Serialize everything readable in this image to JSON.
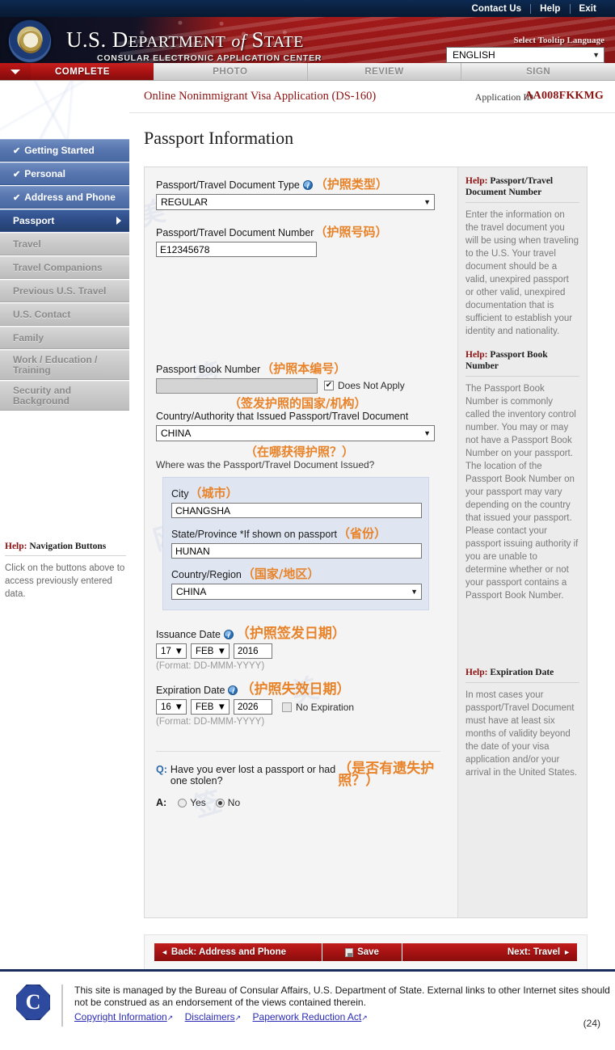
{
  "utility": {
    "links": [
      "Contact Us",
      "Help",
      "Exit"
    ]
  },
  "banner": {
    "title_us": "U.S.",
    "title_dept": "D",
    "title_dept_rest": "EPARTMENT",
    "title_of": "of",
    "title_state_s": "S",
    "title_state_rest": "TATE",
    "subtitle": "CONSULAR ELECTRONIC APPLICATION CENTER",
    "tooltip_label": "Select Tooltip Language",
    "language_value": "ENGLISH",
    "caret": "▼"
  },
  "steps": [
    {
      "label": "COMPLETE",
      "state": "active"
    },
    {
      "label": "PHOTO",
      "state": "inactive"
    },
    {
      "label": "REVIEW",
      "state": "inactive"
    },
    {
      "label": "SIGN",
      "state": "inactive"
    }
  ],
  "sidebar": {
    "items": [
      {
        "label": "Getting Started",
        "state": "done",
        "check": "✔"
      },
      {
        "label": "Personal",
        "state": "done",
        "check": "✔"
      },
      {
        "label": "Address and Phone",
        "state": "done",
        "check": "✔"
      },
      {
        "label": "Passport",
        "state": "current",
        "check": ""
      },
      {
        "label": "Travel",
        "state": "disabled",
        "check": ""
      },
      {
        "label": "Travel Companions",
        "state": "disabled",
        "check": ""
      },
      {
        "label": "Previous U.S. Travel",
        "state": "disabled",
        "check": ""
      },
      {
        "label": "U.S. Contact",
        "state": "disabled",
        "check": ""
      },
      {
        "label": "Family",
        "state": "disabled",
        "check": ""
      },
      {
        "label": "Work / Education /",
        "label2": "Training",
        "state": "disabled",
        "check": ""
      },
      {
        "label": "Security and",
        "label2": "Background",
        "state": "disabled",
        "check": ""
      }
    ],
    "help": {
      "title_word": "Help:",
      "title_rest": " Navigation Buttons",
      "body": "Click on the buttons above to access previously entered data."
    }
  },
  "content": {
    "app_title": "Online Nonimmigrant Visa Application (DS-160)",
    "app_id_label": "Application ID",
    "app_id_value": "AA008FKKMG",
    "page_title": "Passport Information"
  },
  "form": {
    "doc_type": {
      "label": "Passport/Travel Document Type",
      "cn": "（护照类型）",
      "value": "REGULAR"
    },
    "doc_number": {
      "label": "Passport/Travel Document Number",
      "cn": "（护照号码）",
      "value": "E12345678"
    },
    "book_number": {
      "label": "Passport Book Number",
      "cn": "（护照本编号）",
      "value": "",
      "checkbox_label": "Does Not Apply",
      "checkbox_checked": true,
      "check_glyph": "✔"
    },
    "issuing_country": {
      "label": "Country/Authority that Issued Passport/Travel Document",
      "cn": "（签发护照的国家/机构）",
      "value": "CHINA"
    },
    "where_issued": {
      "label": "Where was the Passport/Travel Document Issued?",
      "cn": "（在哪获得护照？）"
    },
    "city": {
      "label": "City",
      "cn": "（城市）",
      "value": "CHANGSHA"
    },
    "state_province": {
      "label": "State/Province *If shown on passport",
      "cn": "（省份）",
      "value": "HUNAN"
    },
    "country_region": {
      "label": "Country/Region",
      "cn": "（国家/地区）",
      "value": "CHINA"
    },
    "issuance_date": {
      "label": "Issuance Date",
      "cn": "（护照签发日期）",
      "day": "17",
      "month": "FEB",
      "year": "2016",
      "format": "(Format: DD-MMM-YYYY)"
    },
    "expiration_date": {
      "label": "Expiration Date",
      "cn": "（护照失效日期）",
      "day": "16",
      "month": "FEB",
      "year": "2026",
      "format": "(Format: DD-MMM-YYYY)",
      "no_expiration_label": "No Expiration",
      "no_expiration_checked": false
    },
    "question": {
      "q_tag": "Q:",
      "q_text": "Have you ever lost a passport or had one stolen?",
      "cn": "（是否有遗失护照？）",
      "a_tag": "A:",
      "option_yes": "Yes",
      "option_no": "No",
      "selected": "No"
    }
  },
  "help_panel": [
    {
      "title_word": "Help:",
      "title_rest": " Passport/Travel Document Number",
      "body": "Enter the information on the travel document you will be using when traveling to the U.S. Your travel document should be a valid, unexpired passport or other valid, unexpired documentation that is sufficient to establish your identity and nationality."
    },
    {
      "title_word": "Help:",
      "title_rest": " Passport Book Number",
      "body": "The Passport Book Number is commonly called the inventory control number. You may or may not have a Passport Book Number on your passport. The location of the Passport Book Number on your passport may vary depending on the country that issued your passport. Please contact your passport issuing authority if you are unable to determine whether or not your passport contains a Passport Book Number."
    },
    {
      "title_word": "Help:",
      "title_rest": " Expiration Date",
      "body": "In most cases your passport/Travel Document must have at least six months of validity beyond the date of your visa application and/or your arrival in the United States."
    }
  ],
  "actions": {
    "back": "Back: Address and Phone",
    "back_arrow": "◄",
    "save": "Save",
    "next": "Next: Travel",
    "next_arrow": "►"
  },
  "footer": {
    "text": "This site is managed by the Bureau of Consular Affairs, U.S. Department of State. External links to other Internet sites should not be construed as an endorsement of the views contained therein.",
    "links": [
      "Copyright Information",
      "Disclaimers",
      "Paperwork Reduction Act"
    ],
    "ext_glyph": "↗",
    "page_number": "(24)",
    "seal_letter": "C"
  },
  "colors": {
    "brand_red": "#8c1111",
    "banner_red": "#a41212",
    "nav_blue": "#5775ae",
    "nav_current": "#2d4b86",
    "annotation_orange": "#e8832a",
    "link_blue": "#2b2bb5",
    "footer_navy": "#1a2c5c"
  }
}
